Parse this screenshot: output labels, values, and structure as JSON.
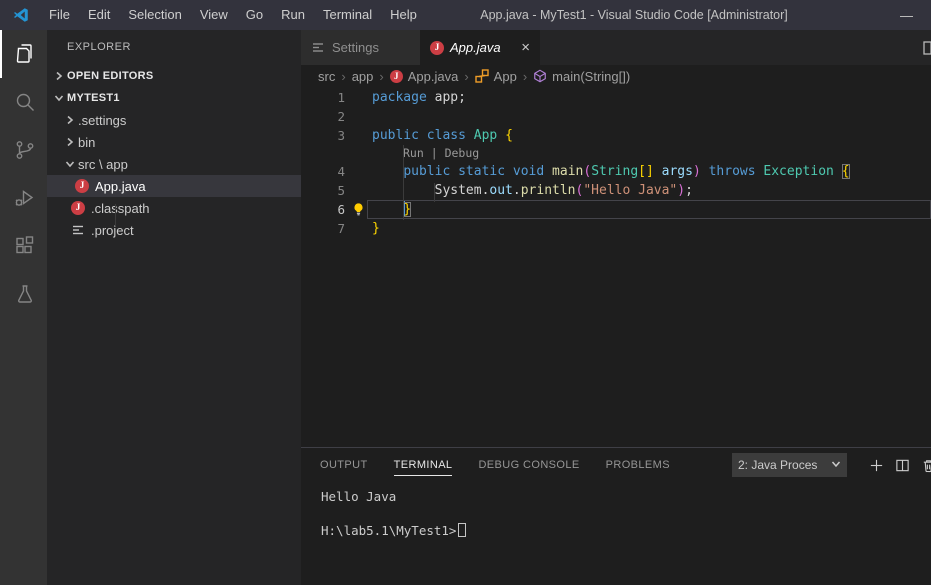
{
  "title_bar": {
    "menus": [
      "File",
      "Edit",
      "Selection",
      "View",
      "Go",
      "Run",
      "Terminal",
      "Help"
    ],
    "title": "App.java - MyTest1 - Visual Studio Code [Administrator]",
    "minimize": "—"
  },
  "activity_bar": {
    "items": [
      "explorer",
      "search",
      "source-control",
      "run-and-debug",
      "extensions",
      "test"
    ]
  },
  "sidebar": {
    "header": "EXPLORER",
    "sections": {
      "open_editors": "OPEN EDITORS",
      "folder": "MYTEST1"
    },
    "tree": [
      {
        "label": ".settings"
      },
      {
        "label": "bin"
      },
      {
        "label": "src \\ app"
      },
      {
        "label": "App.java"
      },
      {
        "label": ".classpath"
      },
      {
        "label": ".project"
      }
    ]
  },
  "tabs": [
    {
      "label": "Settings"
    },
    {
      "label": "App.java",
      "close": "×"
    }
  ],
  "breadcrumbs": {
    "items": [
      "src",
      "app",
      "App.java",
      "App",
      "main(String[])"
    ],
    "separator": "›"
  },
  "editor": {
    "java_badge": "J",
    "codelens": {
      "run": "Run",
      "separator": " | ",
      "debug": "Debug"
    },
    "lines": [
      {
        "num": "1",
        "tokens": [
          {
            "c": "kw",
            "t": "package"
          },
          {
            "c": "pl",
            "t": " app;"
          }
        ]
      },
      {
        "num": "2",
        "tokens": []
      },
      {
        "num": "3",
        "tokens": [
          {
            "c": "kw",
            "t": "public"
          },
          {
            "c": "pl",
            "t": " "
          },
          {
            "c": "kw",
            "t": "class"
          },
          {
            "c": "pl",
            "t": " "
          },
          {
            "c": "type",
            "t": "App"
          },
          {
            "c": "pl",
            "t": " "
          },
          {
            "c": "b1",
            "t": "{"
          }
        ]
      },
      {
        "num": "4",
        "tokens": [
          {
            "c": "pl",
            "t": "    "
          },
          {
            "c": "kw",
            "t": "public"
          },
          {
            "c": "pl",
            "t": " "
          },
          {
            "c": "kw",
            "t": "static"
          },
          {
            "c": "pl",
            "t": " "
          },
          {
            "c": "kw",
            "t": "void"
          },
          {
            "c": "pl",
            "t": " "
          },
          {
            "c": "fn",
            "t": "main"
          },
          {
            "c": "b2",
            "t": "("
          },
          {
            "c": "type",
            "t": "String"
          },
          {
            "c": "b1",
            "t": "[]"
          },
          {
            "c": "pl",
            "t": " "
          },
          {
            "c": "var",
            "t": "args"
          },
          {
            "c": "b2",
            "t": ")"
          },
          {
            "c": "pl",
            "t": " "
          },
          {
            "c": "kw",
            "t": "throws"
          },
          {
            "c": "pl",
            "t": " "
          },
          {
            "c": "type",
            "t": "Exception"
          },
          {
            "c": "pl",
            "t": " "
          },
          {
            "c": "b1 box",
            "t": "{"
          }
        ]
      },
      {
        "num": "5",
        "tokens": [
          {
            "c": "pl",
            "t": "        System."
          },
          {
            "c": "var",
            "t": "out"
          },
          {
            "c": "pl",
            "t": "."
          },
          {
            "c": "fn",
            "t": "println"
          },
          {
            "c": "b2",
            "t": "("
          },
          {
            "c": "str",
            "t": "\"Hello Java\""
          },
          {
            "c": "b2",
            "t": ")"
          },
          {
            "c": "pl",
            "t": ";"
          }
        ]
      },
      {
        "num": "6",
        "tokens": [
          {
            "c": "pl",
            "t": "    "
          },
          {
            "c": "caret",
            "t": ""
          },
          {
            "c": "b1 box",
            "t": "}"
          }
        ]
      },
      {
        "num": "7",
        "tokens": [
          {
            "c": "b1",
            "t": "}"
          }
        ]
      }
    ]
  },
  "panel": {
    "tabs": [
      {
        "label": "OUTPUT"
      },
      {
        "label": "TERMINAL"
      },
      {
        "label": "DEBUG CONSOLE"
      },
      {
        "label": "PROBLEMS"
      }
    ],
    "terminal_picker": "2: Java Proces",
    "terminal_lines": [
      "Hello Java",
      "",
      "H:\\lab5.1\\MyTest1>"
    ]
  },
  "colors": {
    "titlebar_bg": "#33333d",
    "activitybar_bg": "#333333",
    "sidebar_bg": "#252526",
    "editor_bg": "#1e1e1e",
    "selection_bg": "#37373d",
    "java_icon_red": "#cc3e44",
    "keyword_blue": "#569cd6",
    "type_teal": "#4ec9b0",
    "function_yellow": "#dcdcaa",
    "variable_blue": "#9cdcfe",
    "string_orange": "#ce9178",
    "bracket_gold": "#ffd700",
    "bracket_pink": "#da70d6",
    "class_icon_orange": "#ee9d28",
    "method_icon_purple": "#b180d7",
    "lightbulb_yellow": "#ffcc00"
  }
}
